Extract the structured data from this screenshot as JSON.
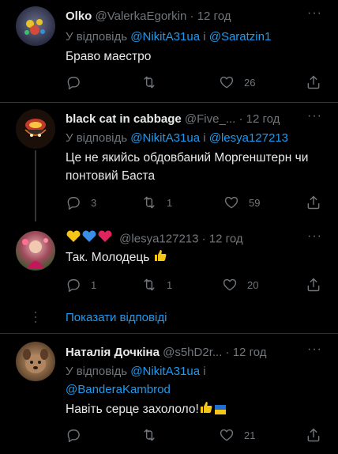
{
  "colors": {
    "background": "#000000",
    "text": "#e7e9ea",
    "muted": "#71767b",
    "accent": "#1d9bf0",
    "divider": "#2f3336"
  },
  "tweets": [
    {
      "name": "Olko",
      "handle": "@ValerkaEgorkin",
      "separator": "·",
      "time": "12 год",
      "more": "···",
      "reply_prefix": "У відповідь ",
      "mentions": [
        "@NikitA31ua",
        "@Saratzin1"
      ],
      "mention_joiner": " і ",
      "text": "Браво маестро",
      "replies": "",
      "retweets": "",
      "likes": "26"
    },
    {
      "name": "black cat in cabbage",
      "handle": "@Five_...",
      "separator": "·",
      "time": "12 год",
      "more": "···",
      "reply_prefix": "У відповідь ",
      "mentions": [
        "@NikitA31ua",
        "@lesya127213"
      ],
      "mention_joiner": " і ",
      "text": "Це не якийсь обдовбаний Моргенштерн чи понтовий Баста",
      "replies": "3",
      "retweets": "1",
      "likes": "59"
    },
    {
      "name_emoji": [
        "yellow-heart",
        "blue-heart",
        "red-heart"
      ],
      "handle": "@lesya127213",
      "separator": "·",
      "time": "12 год",
      "more": "···",
      "text": "Так. Молодець",
      "replies": "1",
      "retweets": "1",
      "likes": "20"
    },
    {
      "name": "Наталія Дочкіна",
      "handle": "@s5hD2r...",
      "separator": "·",
      "time": "12 год",
      "more": "···",
      "reply_prefix": "У відповідь ",
      "mentions": [
        "@NikitA31ua",
        "@BanderaKambrod"
      ],
      "mention_joiner": " і",
      "text": "Навіть серце захололо!",
      "replies": "",
      "retweets": "",
      "likes": "21"
    }
  ],
  "show_replies_label": "Показати відповіді",
  "icons": [
    "reply-icon",
    "retweet-icon",
    "like-icon",
    "share-icon",
    "more-icon",
    "thumbs-up-icon",
    "ukraine-flag-icon"
  ]
}
